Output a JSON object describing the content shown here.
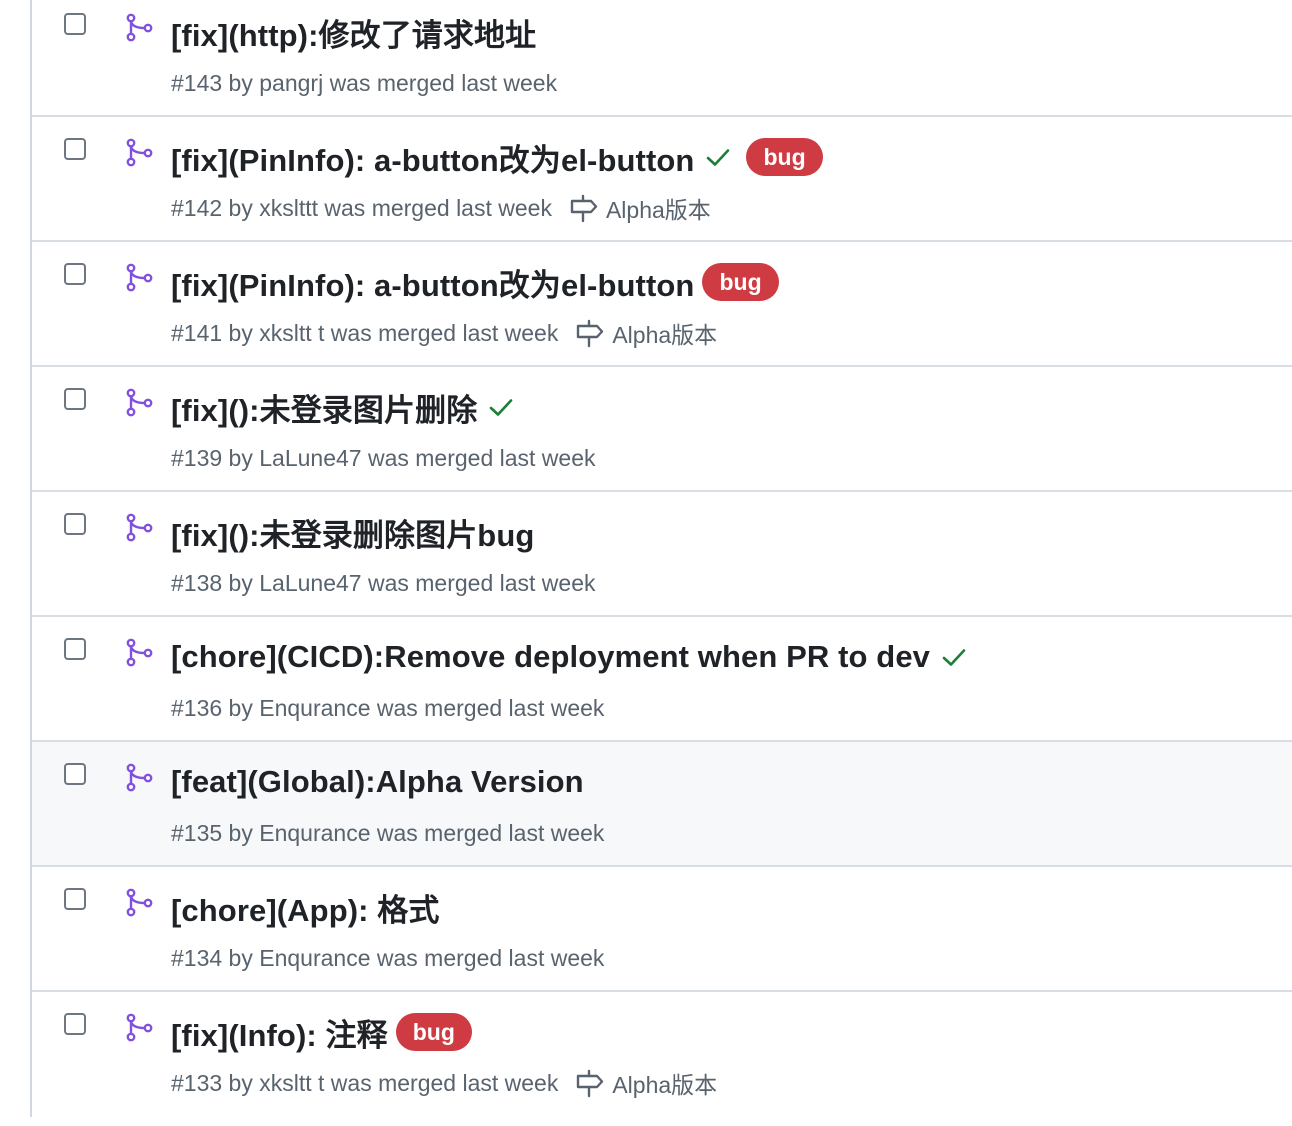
{
  "colors": {
    "merged_icon": "#8250df",
    "check_success": "#1a7f37",
    "label_bug_bg": "#cf3b42",
    "label_bug_text": "#ffffff",
    "meta_text": "#59636e",
    "row_hover_bg": "#f6f8fa"
  },
  "icons": {
    "merged": "git-merge-icon",
    "status": "check-icon",
    "milestone": "milestone-icon"
  },
  "pull_requests": [
    {
      "title": "[fix](http):修改了请求地址",
      "meta": "#143 by pangrj was merged last week",
      "check": false,
      "label": null,
      "milestone": null
    },
    {
      "title": "[fix](PinInfo): a-button改为el-button",
      "meta": "#142 by xkslttt was merged last week",
      "check": true,
      "label": "bug",
      "milestone": "Alpha版本"
    },
    {
      "title": "[fix](PinInfo): a-button改为el-button",
      "meta": "#141 by xksltt t was merged last week",
      "check": false,
      "label": "bug",
      "milestone": "Alpha版本"
    },
    {
      "title": "[fix]():未登录图片删除",
      "meta": "#139 by LaLune47 was merged last week",
      "check": true,
      "label": null,
      "milestone": null
    },
    {
      "title": "[fix]():未登录删除图片bug",
      "meta": "#138 by LaLune47 was merged last week",
      "check": false,
      "label": null,
      "milestone": null
    },
    {
      "title": "[chore](CICD):Remove deployment when PR to dev",
      "meta": "#136 by Enqurance was merged last week",
      "check": true,
      "label": null,
      "milestone": null
    },
    {
      "title": "[feat](Global):Alpha Version",
      "meta": "#135 by Enqurance was merged last week",
      "check": false,
      "label": null,
      "milestone": null
    },
    {
      "title": "[chore](App): 格式",
      "meta": "#134 by Enqurance was merged last week",
      "check": false,
      "label": null,
      "milestone": null
    },
    {
      "title": "[fix](Info): 注释",
      "meta": "#133 by xksltt t was merged last week",
      "check": false,
      "label": "bug",
      "milestone": "Alpha版本"
    }
  ]
}
